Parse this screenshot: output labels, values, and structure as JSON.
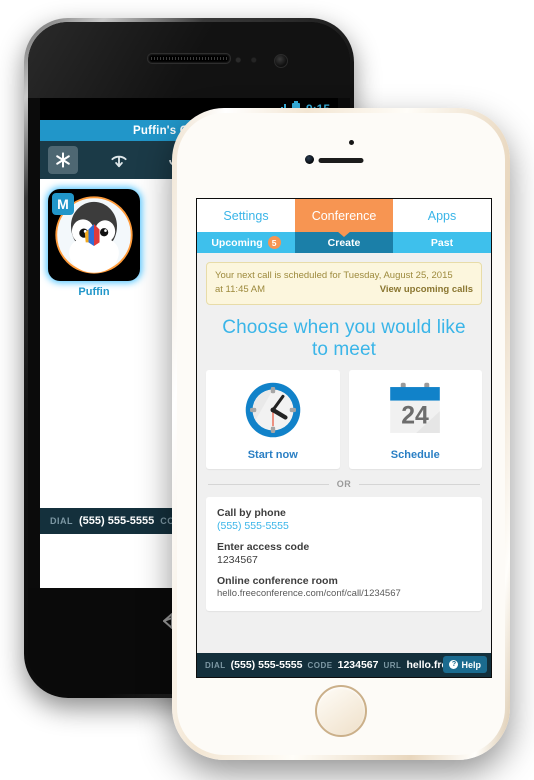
{
  "android": {
    "status_bar": {
      "time": "9:15",
      "signal_icon": "signal-bars-icon",
      "battery_icon": "battery-icon"
    },
    "title": "Puffin's Conference",
    "toolbar": [
      {
        "name": "asterisk-keypad-icon",
        "glyph": "✳",
        "active": true
      },
      {
        "name": "hangup-phone-icon",
        "glyph": "",
        "active": false
      },
      {
        "name": "microphone-icon",
        "glyph": "",
        "active": false
      }
    ],
    "participant": {
      "badge": "M",
      "name": "Puffin",
      "avatar_icon": "puffin-avatar-icon"
    },
    "bottom_bar": {
      "dial_label": "DIAL",
      "dial_value": "(555) 555-5555",
      "code_label": "CODE"
    },
    "nav": {
      "back_icon": "back-arrow-icon"
    }
  },
  "iphone": {
    "main_tabs": [
      {
        "label": "Settings",
        "active": false
      },
      {
        "label": "Conference",
        "active": true
      },
      {
        "label": "Apps",
        "active": false
      }
    ],
    "sub_tabs": [
      {
        "label": "Upcoming",
        "badge": "5",
        "active": false
      },
      {
        "label": "Create",
        "badge": "",
        "active": true
      },
      {
        "label": "Past",
        "badge": "",
        "active": false
      }
    ],
    "notice": {
      "line1": "Your next call is scheduled for Tuesday, August 25, 2015",
      "line2": "at 11:45 AM",
      "link": "View upcoming calls"
    },
    "headline": "Choose when you would like to meet",
    "choices": [
      {
        "label": "Start now",
        "icon": "clock-icon"
      },
      {
        "label": "Schedule",
        "icon": "calendar-icon",
        "day": "24"
      }
    ],
    "divider_text": "OR",
    "info": [
      {
        "title": "Call by phone",
        "value": "(555) 555-5555",
        "style": "link"
      },
      {
        "title": "Enter access code",
        "value": "1234567",
        "style": "plain"
      },
      {
        "title": "Online conference room",
        "value": "hello.freeconference.com/conf/call/1234567",
        "style": "url"
      }
    ],
    "bottom_bar": {
      "dial_label": "DIAL",
      "dial_value": "(555) 555-5555",
      "code_label": "CODE",
      "code_value": "1234567",
      "url_label": "URL",
      "url_value": "hello.freeco",
      "help_label": "Help"
    }
  },
  "colors": {
    "brand_blue": "#3ab5e8",
    "accent_orange": "#f79552",
    "tab_blue": "#3ec0ec",
    "tab_blue_active": "#1b7fa8",
    "darkbar": "#14303c",
    "notice_bg": "#fcf6dd"
  }
}
